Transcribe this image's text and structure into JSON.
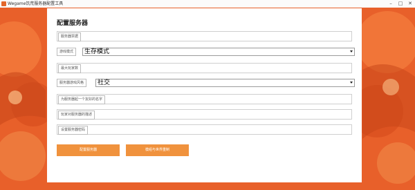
{
  "window": {
    "title": "Wegame饥荒服务器配置工具",
    "minimize_glyph": "–",
    "maximize_glyph": "□",
    "close_glyph": "✕"
  },
  "panel": {
    "title": "配置服务器"
  },
  "fields": {
    "server_name": {
      "label": "服务器票据",
      "value": ""
    },
    "game_mode": {
      "label": "游戏模式",
      "value": "生存模式"
    },
    "max_players": {
      "label": "最大玩家数",
      "value": ""
    },
    "play_style": {
      "label": "服务器游戏风格",
      "value": "社交"
    },
    "friendly_name": {
      "label": "为服务器起一个友好的名字",
      "value": ""
    },
    "description": {
      "label": "玩家对服务器的描述",
      "value": ""
    },
    "password": {
      "label": "设置服务器密码",
      "value": ""
    }
  },
  "buttons": {
    "configure": "配置服务器",
    "world_settings": "模组与世界重制"
  },
  "colors": {
    "background": "#e8602a",
    "button": "#f0923d",
    "panel": "#ffffff"
  }
}
